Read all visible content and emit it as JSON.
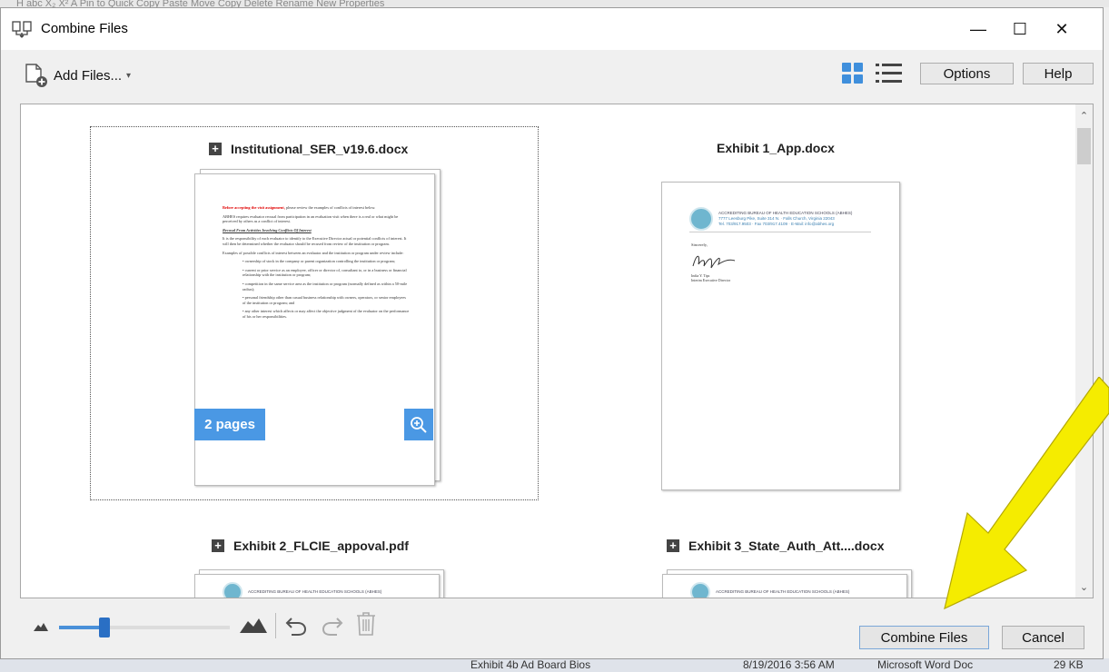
{
  "background": {
    "top_strip_text": "H   abc  X₂  X²   A   Pin to Quick   Copy   Paste          Move   Copy   Delete  Rename      New                    Properties",
    "bottom_items": [
      "Exhibit 4b Ad Board Bios",
      "8/19/2016 3:56 AM",
      "Microsoft Word Doc",
      "29 KB"
    ]
  },
  "window": {
    "title": "Combine Files",
    "minimize_glyph": "—",
    "maximize_glyph": "☐",
    "close_glyph": "✕"
  },
  "toolbar": {
    "add_files_label": "Add Files...",
    "add_files_caret": "▾",
    "options_label": "Options",
    "help_label": "Help"
  },
  "files": [
    {
      "name": "Institutional_SER_v19.6.docx",
      "pages_badge": "2 pages",
      "selected": true,
      "expandable": true
    },
    {
      "name": "Exhibit 1_App.docx",
      "selected": false,
      "expandable": false
    },
    {
      "name": "Exhibit 2_FLCIE_appoval.pdf",
      "selected": false,
      "expandable": true
    },
    {
      "name": "Exhibit 3_State_Auth_Att....docx",
      "selected": false,
      "expandable": true
    }
  ],
  "thumbnail_text": {
    "p1_red": "Before accepting the visit assignment,",
    "p1_rest": " please review the examples of conflicts of interest below.",
    "p2": "ABHES requires evaluator recusal from participation in an evaluation visit when there is a real or what might be perceived by others as a conflict of interest.",
    "p3": "Recusal From Activities Involving Conflicts Of Interest",
    "p4": "It is the responsibility of each evaluator to identify to the Executive Director actual or potential conflicts of interest. It will then be determined whether the evaluator should be recused from review of the institution or program.",
    "p5": "Examples of possible conflicts of interest between an evaluator and the institution or program under review include:",
    "bullets": [
      "ownership of stock in the company or parent organization controlling the institution or program;",
      "current or prior service as an employee, officer or director of, consultant to, or in a business or financial relationship with the institution or program;",
      "competition in the same service area as the institution or program (normally defined as within a 50-mile radius);",
      "personal friendship other than casual business relationship with owners, operators, or senior employees of the institution or program; and",
      "any other interest which affects or may affect the objective judgment of the evaluator on the performance of his or her responsibilities."
    ],
    "letterhead": "ACCREDITING BUREAU OF HEALTH EDUCATION SCHOOLS (ABHES)",
    "letterhead_address": "7777 Leesburg Pike, Suite 314 N. · Falls Church, Virginia 22043",
    "letterhead_contact": "Tel. 703/917.9503 · Fax 703/917.4109 · E-Mail: info@abhes.org",
    "salutation": "Sincerely,",
    "signer_name": "India Y. Tips",
    "signer_title": "Interim Executive Director"
  },
  "footer": {
    "combine_label": "Combine Files",
    "cancel_label": "Cancel"
  },
  "colors": {
    "accent": "#4a98e4",
    "arrow": "#f5ec00"
  }
}
